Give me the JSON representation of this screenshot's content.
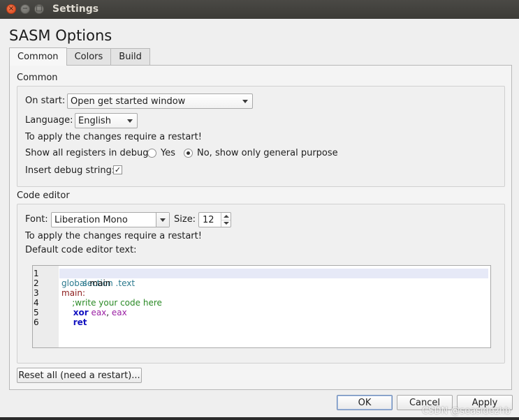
{
  "window": {
    "title": "Settings"
  },
  "heading": "SASM Options",
  "tabs": [
    {
      "label": "Common",
      "active": true
    },
    {
      "label": "Colors",
      "active": false
    },
    {
      "label": "Build",
      "active": false
    }
  ],
  "common": {
    "group_title": "Common",
    "on_start_label": "On start:",
    "on_start_value": "Open get started window",
    "language_label": "Language:",
    "language_value": "English",
    "restart_note": "To apply the changes require a restart!",
    "registers_label": "Show all registers in debug:",
    "registers_yes": "Yes",
    "registers_no": "No, show only general purpose",
    "registers_selected": "No, show only general purpose",
    "debug_string_label": "Insert debug string:",
    "debug_string_checked": true,
    "debug_string_mark": "✓"
  },
  "code_editor": {
    "group_title": "Code editor",
    "font_label": "Font:",
    "font_value": "Liberation Mono",
    "size_label": "Size:",
    "size_value": "12",
    "restart_note": "To apply the changes require a restart!",
    "default_text_label": "Default code editor text:",
    "line_numbers": [
      "1",
      "2",
      "3",
      "4",
      "5",
      "6"
    ],
    "lines": {
      "l1": "section .text",
      "l2a": "global",
      "l2b": " main",
      "l3": "main:",
      "l4": "    ;write your code here",
      "l5a": "    xor",
      "l5b": " eax",
      "l5c": ", ",
      "l5d": "eax",
      "l6": "    ret"
    },
    "colors": {
      "section": "#2c7a8e",
      "label": "#8b1a1a",
      "comment": "#2a8a25",
      "instruction": "#1212c0",
      "register": "#9a1fa3",
      "current_line": "#e6e9f7"
    }
  },
  "reset_button": "Reset all (need a restart)...",
  "footer": {
    "ok": "OK",
    "cancel": "Cancel",
    "apply": "Apply"
  },
  "watermark": "CSDN @seasidezhb",
  "icons": {
    "close": "close-icon",
    "minimize": "minimize-icon",
    "maximize": "maximize-icon"
  }
}
